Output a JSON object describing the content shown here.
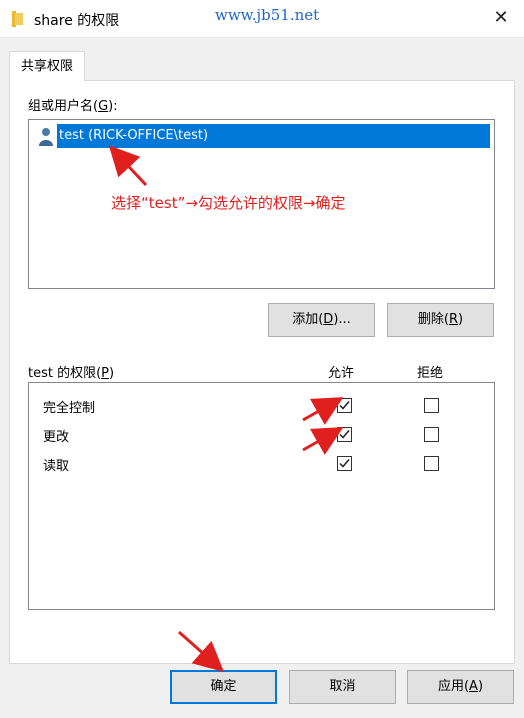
{
  "window": {
    "title": "share 的权限",
    "watermark": "www.jb51.net",
    "close_glyph": "✕"
  },
  "tab": {
    "label": "共享权限"
  },
  "users_section": {
    "label_prefix": "组或用户名(",
    "label_key": "G",
    "label_suffix": "):",
    "users": [
      {
        "name": "test (RICK-OFFICE\\test)",
        "selected": true,
        "icon": "user-icon"
      }
    ]
  },
  "annotation": {
    "text": "选择“test”→勾选允许的权限→确定",
    "color": "#e0201f"
  },
  "user_buttons": {
    "add_prefix": "添加(",
    "add_key": "D",
    "add_suffix": ")...",
    "remove_prefix": "删除(",
    "remove_key": "R",
    "remove_suffix": ")"
  },
  "permissions": {
    "label_prefix": "test 的权限(",
    "label_key": "P",
    "label_suffix": ")",
    "allow_header": "允许",
    "deny_header": "拒绝",
    "rows": [
      {
        "name": "完全控制",
        "allow": true,
        "deny": false
      },
      {
        "name": "更改",
        "allow": true,
        "deny": false
      },
      {
        "name": "读取",
        "allow": true,
        "deny": false
      }
    ]
  },
  "footer": {
    "ok": "确定",
    "cancel": "取消",
    "apply_prefix": "应用(",
    "apply_key": "A",
    "apply_suffix": ")"
  },
  "colors": {
    "selection": "#0078d7",
    "annotation_red": "#e0201f",
    "watermark_blue": "#1e66c9"
  }
}
